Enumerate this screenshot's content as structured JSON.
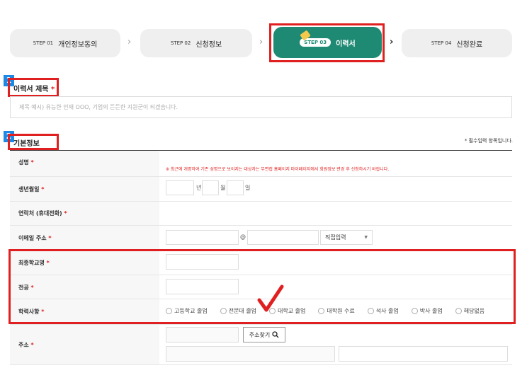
{
  "steps": [
    {
      "num": "STEP 01",
      "label": "개인정보동의"
    },
    {
      "num": "STEP 02",
      "label": "신청정보"
    },
    {
      "num": "STEP 03",
      "label": "이력서"
    },
    {
      "num": "STEP 04",
      "label": "신청완료"
    }
  ],
  "step_arrow": "›",
  "badges": {
    "one": "1",
    "two": "2"
  },
  "resume_title": {
    "label": "이력서 제목",
    "required_mark": "*",
    "placeholder": "제목 예시) 유능한 인재 OOO, 기업의 든든한 지원군이 되겠습니다."
  },
  "basic_info": {
    "label": "기본정보",
    "required_note": "* 필수입력 항목입니다."
  },
  "rows": {
    "name": {
      "label": "성명",
      "req": "*",
      "notice": "※ 최근에 개명하여 기존 성명으로 보이지는 대상자는 무면접 홈페이지 마이페이지에서 회원정보 변경 후 신청하시기 바랍니다."
    },
    "birth": {
      "label": "생년월일",
      "req": "*",
      "year": "년",
      "month": "월",
      "day": "일"
    },
    "phone": {
      "label": "연락처 (휴대전화)",
      "req": "*"
    },
    "email": {
      "label": "이메일 주소",
      "req": "*",
      "at": "@",
      "select": "직접입력",
      "select_arrow": "▼"
    },
    "school": {
      "label": "최종학교명",
      "req": "*"
    },
    "major": {
      "label": "전공",
      "req": "*"
    },
    "education": {
      "label": "학력사항",
      "req": "*",
      "options": [
        "고등학교 졸업",
        "전문대 졸업",
        "대학교 졸업",
        "대학원 수료",
        "석사 졸업",
        "박사 졸업",
        "해당없음"
      ]
    },
    "address": {
      "label": "주소",
      "req": "*",
      "button": "주소찾기",
      "button_icon": "magnifier-icon"
    }
  },
  "colors": {
    "accent": "#1f8a73",
    "highlight": "#e02020",
    "badge": "#1e88e5"
  }
}
